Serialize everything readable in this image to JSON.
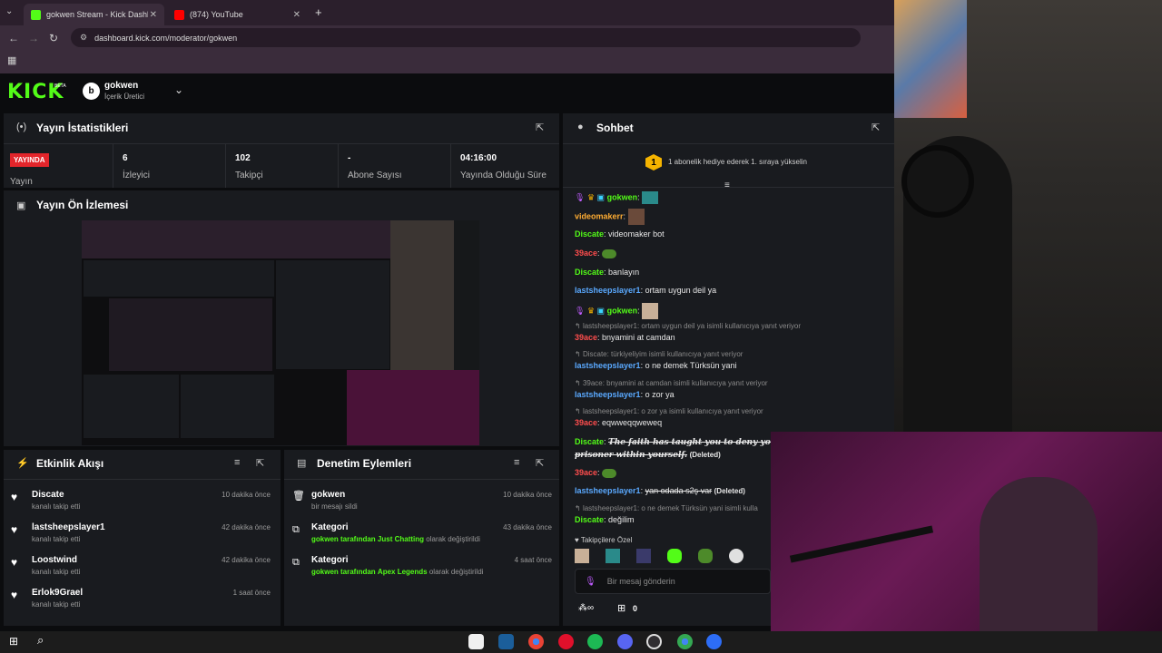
{
  "browser": {
    "tabs": [
      {
        "title": "gokwen Stream - Kick Dashboard",
        "color": "#53fc18",
        "active": true
      },
      {
        "title": "(874) YouTube",
        "color": "#ff0000",
        "active": false
      }
    ],
    "url": "dashboard.kick.com/moderator/gokwen"
  },
  "header": {
    "logo": "KICK",
    "beta": "BETA",
    "avatar_letter": "b",
    "user": "gokwen",
    "role": "İçerik Üretici"
  },
  "stats": {
    "title": "Yayın İstatistikleri",
    "live_badge": "YAYINDA",
    "live_label": "Yayın",
    "cells": [
      {
        "value": "6",
        "label": "İzleyici"
      },
      {
        "value": "102",
        "label": "Takipçi"
      },
      {
        "value": "-",
        "label": "Abone Sayısı"
      },
      {
        "value": "04:16:00",
        "label": "Yayında Olduğu Süre"
      }
    ]
  },
  "preview": {
    "title": "Yayın Ön İzlemesi"
  },
  "activity": {
    "title": "Etkinlik Akışı",
    "items": [
      {
        "user": "Discate",
        "action": "kanalı takip etti",
        "time": "10 dakika önce"
      },
      {
        "user": "lastsheepslayer1",
        "action": "kanalı takip etti",
        "time": "42 dakika önce"
      },
      {
        "user": "Loostwind",
        "action": "kanalı takip etti",
        "time": "42 dakika önce"
      },
      {
        "user": "Erlok9Grael",
        "action": "kanalı takip etti",
        "time": "1 saat önce"
      }
    ]
  },
  "moderation": {
    "title": "Denetim Eylemleri",
    "items": [
      {
        "user": "gokwen",
        "pre": "",
        "highlight": "",
        "text": "bir mesajı sildi",
        "time": "10 dakika önce"
      },
      {
        "user": "Kategori",
        "pre": "gokwen tarafından",
        "highlight": "Just Chatting",
        "text": "olarak değiştirildi",
        "time": "43 dakika önce"
      },
      {
        "user": "Kategori",
        "pre": "gokwen tarafından",
        "highlight": "Apex Legends",
        "text": "olarak değiştirildi",
        "time": "4 saat önce"
      }
    ]
  },
  "chat": {
    "title": "Sohbet",
    "gift_badge": "1",
    "gift_text": "1 abonelik hediye ederek 1. sıraya yükselin",
    "messages": [
      {
        "reply": "",
        "user": "gokwen",
        "cls": "u-green",
        "text": ""
      },
      {
        "reply": "",
        "user": "videomakerr",
        "cls": "u-orange",
        "text": ""
      },
      {
        "reply": "",
        "user": "Discate",
        "cls": "u-green",
        "text": "videomaker bot"
      },
      {
        "reply": "",
        "user": "39ace",
        "cls": "u-red",
        "text": ""
      },
      {
        "reply": "",
        "user": "Discate",
        "cls": "u-green",
        "text": "banlayın"
      },
      {
        "reply": "",
        "user": "lastsheepslayer1",
        "cls": "u-blue",
        "text": "ortam uygun deil ya"
      },
      {
        "reply": "",
        "user": "gokwen",
        "cls": "u-green",
        "text": ""
      },
      {
        "reply": "lastsheepslayer1: ortam uygun deil ya isimli kullanıcıya yanıt veriyor",
        "user": "39ace",
        "cls": "u-red",
        "text": "bnyamini at camdan"
      },
      {
        "reply": "Discate: türkiyeliyim isimli kullanıcıya yanıt veriyor",
        "user": "lastsheepslayer1",
        "cls": "u-blue",
        "text": "o ne demek Türksün yani"
      },
      {
        "reply": "39ace: bnyamini at camdan isimli kullanıcıya yanıt veriyor",
        "user": "lastsheepslayer1",
        "cls": "u-blue",
        "text": "o zor ya"
      },
      {
        "reply": "lastsheepslayer1: o zor ya isimli kullanıcıya yanıt veriyor",
        "user": "39ace",
        "cls": "u-red",
        "text": "eqwweqqweweq"
      }
    ],
    "deleted1_user": "Discate",
    "deleted1_text": "The faith has taught you to deny your heart's",
    "deleted1_text2": "prisoner within yourself.",
    "deleted_tag": "(Deleted)",
    "deleted2_user": "lastsheepslayer1",
    "deleted2_text": "yan odada s2ş var",
    "user39": "39ace",
    "last_reply": "lastsheepslayer1: o ne demek Türksün yani isimli kulla",
    "last_user": "Discate",
    "last_text": "değilim",
    "follower_only": "Takipçilere Özel",
    "input_placeholder": "Bir mesaj gönderin",
    "counter": "0",
    "infinity": "∞"
  }
}
